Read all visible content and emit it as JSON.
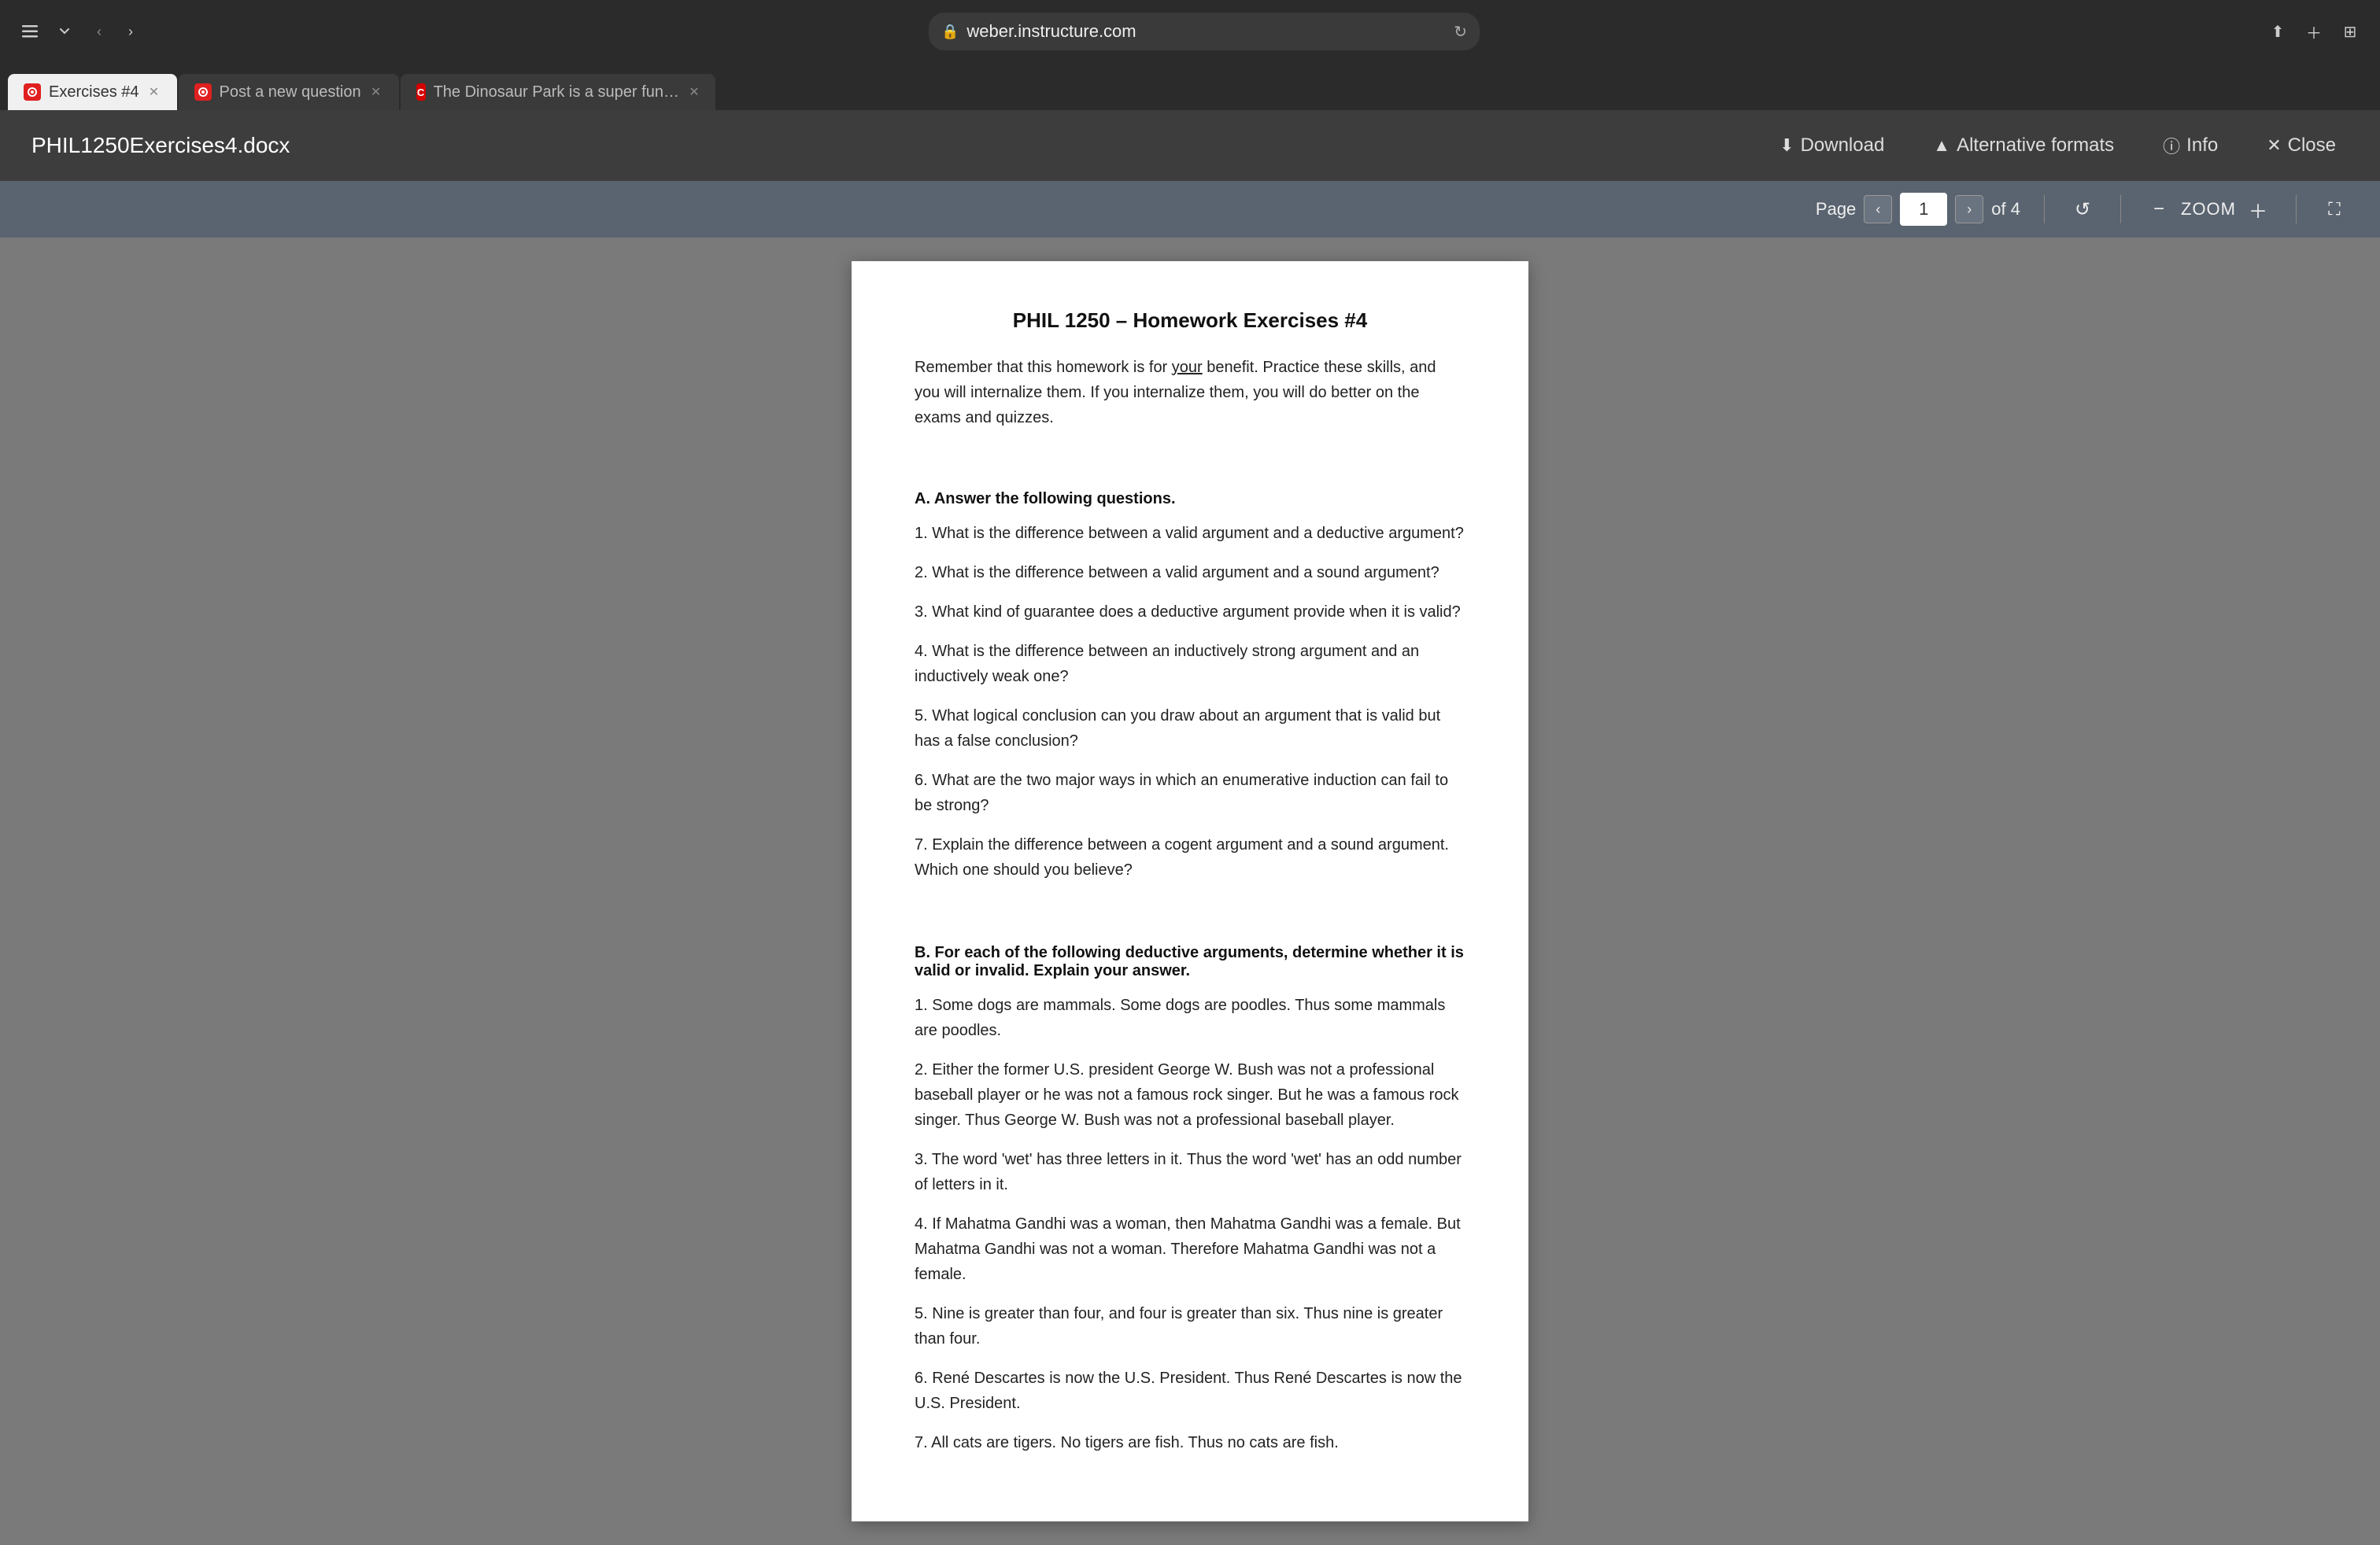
{
  "browser": {
    "url": "weber.instructure.com",
    "tabs": [
      {
        "id": "exercises",
        "label": "Exercises #4",
        "favicon_type": "canvas",
        "active": true
      },
      {
        "id": "post-question",
        "label": "Post a new question",
        "favicon_type": "canvas",
        "active": false
      },
      {
        "id": "chegg",
        "label": "The Dinosaur Park is a super fun place for kids he... | Chegg.com",
        "favicon_type": "chegg",
        "active": false
      }
    ]
  },
  "doc_header": {
    "title": "PHIL1250Exercises4.docx",
    "download_label": "Download",
    "alt_formats_label": "Alternative formats",
    "info_label": "Info",
    "close_label": "Close"
  },
  "toolbar": {
    "page_label": "Page",
    "current_page": "1",
    "total_pages": "of 4",
    "zoom_label": "ZOOM"
  },
  "document": {
    "title": "PHIL 1250 – Homework Exercises #4",
    "intro": "Remember that this homework is for your benefit. Practice these skills, and you will internalize them. If you internalize them, you will do better on the exams and quizzes.",
    "section_a_header": "A. Answer the following questions.",
    "section_a_questions": [
      "1. What is the difference between a valid argument and a deductive argument?",
      "2. What is the difference between a valid argument and a sound argument?",
      "3. What kind of guarantee does a deductive argument provide when it is valid?",
      "4. What is the difference between an inductively strong argument and an inductively weak one?",
      "5. What logical conclusion can you draw about an argument that is valid but has a false conclusion?",
      "6. What are the two major ways in which an enumerative induction can fail to be strong?",
      "7. Explain the difference between a cogent argument and a sound argument. Which one should you believe?"
    ],
    "section_b_header": "B. For each of the following deductive arguments, determine whether it is valid or invalid. Explain your answer.",
    "section_b_questions": [
      "1. Some dogs are mammals. Some dogs are poodles. Thus some mammals are poodles.",
      "2. Either the former U.S. president George W. Bush was not a professional baseball player or he was not a famous rock singer. But he was a famous rock singer. Thus George W. Bush was not a professional baseball player.",
      "3. The word 'wet' has three letters in it. Thus the word 'wet' has an odd number of letters in it.",
      "4. If Mahatma Gandhi was a woman, then Mahatma Gandhi was a female. But Mahatma Gandhi was not a woman. Therefore Mahatma Gandhi was not a female.",
      "5. Nine is greater than four, and four is greater than six. Thus nine is greater than four.",
      "6. René Descartes is now the U.S. President. Thus René Descartes is now the U.S. President.",
      "7. All cats are tigers. No tigers are fish. Thus no cats are fish."
    ]
  }
}
